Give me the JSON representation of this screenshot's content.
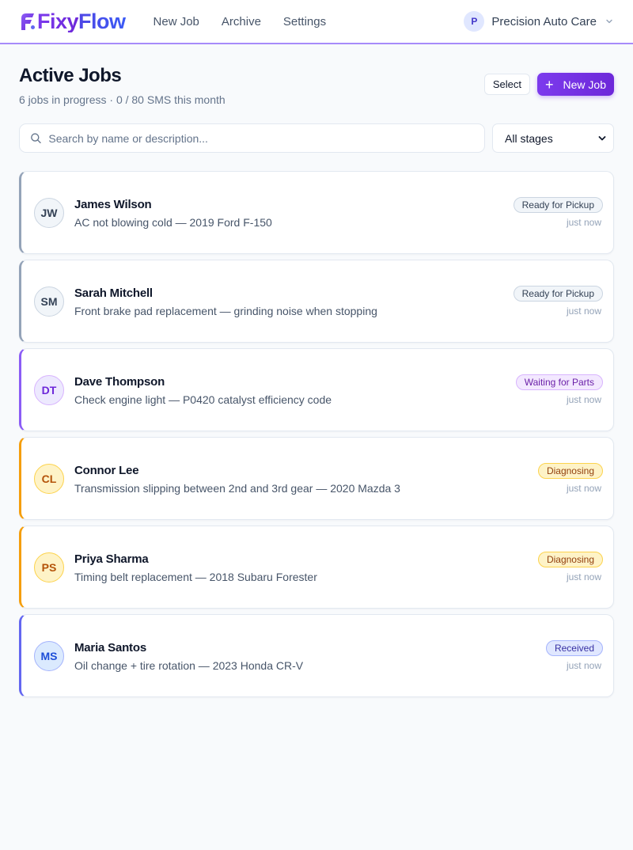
{
  "app": {
    "logo_fixy": "Fixy",
    "logo_flow": "Flow",
    "nav": [
      {
        "label": "New Job"
      },
      {
        "label": "Archive"
      },
      {
        "label": "Settings"
      }
    ],
    "account": {
      "initial": "P",
      "name": "Precision Auto Care"
    }
  },
  "page": {
    "title": "Active Jobs",
    "subtitle": "6 jobs in progress · 0 / 80 SMS this month",
    "select_label": "Select",
    "new_job_label": "New Job",
    "search_placeholder": "Search by name or description...",
    "stage_filter": "All stages"
  },
  "jobs": [
    {
      "initials": "JW",
      "name": "James Wilson",
      "description": "AC not blowing cold — 2019 Ford F-150",
      "status": "Ready for Pickup",
      "time": "just now",
      "accent": "#94a3b8",
      "avatar_bg": "#f1f5f9",
      "avatar_fg": "#334155",
      "badge_bg": "#f1f5f9",
      "badge_fg": "#334155",
      "badge_border": "#cbd5e1"
    },
    {
      "initials": "SM",
      "name": "Sarah Mitchell",
      "description": "Front brake pad replacement — grinding noise when stopping",
      "status": "Ready for Pickup",
      "time": "just now",
      "accent": "#94a3b8",
      "avatar_bg": "#f1f5f9",
      "avatar_fg": "#334155",
      "badge_bg": "#f1f5f9",
      "badge_fg": "#334155",
      "badge_border": "#cbd5e1"
    },
    {
      "initials": "DT",
      "name": "Dave Thompson",
      "description": "Check engine light — P0420 catalyst efficiency code",
      "status": "Waiting for Parts",
      "time": "just now",
      "accent": "#8b5cf6",
      "avatar_bg": "#ede9fe",
      "avatar_fg": "#6d28d9",
      "badge_bg": "#f3e8ff",
      "badge_fg": "#6b21a8",
      "badge_border": "#d8b4fe"
    },
    {
      "initials": "CL",
      "name": "Connor Lee",
      "description": "Transmission slipping between 2nd and 3rd gear — 2020 Mazda 3",
      "status": "Diagnosing",
      "time": "just now",
      "accent": "#f59e0b",
      "avatar_bg": "#fef3c7",
      "avatar_fg": "#b45309",
      "badge_bg": "#fef3c7",
      "badge_fg": "#92400e",
      "badge_border": "#fcd34d"
    },
    {
      "initials": "PS",
      "name": "Priya Sharma",
      "description": "Timing belt replacement — 2018 Subaru Forester",
      "status": "Diagnosing",
      "time": "just now",
      "accent": "#f59e0b",
      "avatar_bg": "#fef3c7",
      "avatar_fg": "#b45309",
      "badge_bg": "#fef3c7",
      "badge_fg": "#92400e",
      "badge_border": "#fcd34d"
    },
    {
      "initials": "MS",
      "name": "Maria Santos",
      "description": "Oil change + tire rotation — 2023 Honda CR-V",
      "status": "Received",
      "time": "just now",
      "accent": "#6366f1",
      "avatar_bg": "#dbeafe",
      "avatar_fg": "#1d4ed8",
      "badge_bg": "#e0e7ff",
      "badge_fg": "#3730a3",
      "badge_border": "#a5b4fc"
    }
  ],
  "colors": {
    "brand_primary": "#7c3aed",
    "brand_secondary": "#4f46e5",
    "background": "#f8fafc"
  }
}
